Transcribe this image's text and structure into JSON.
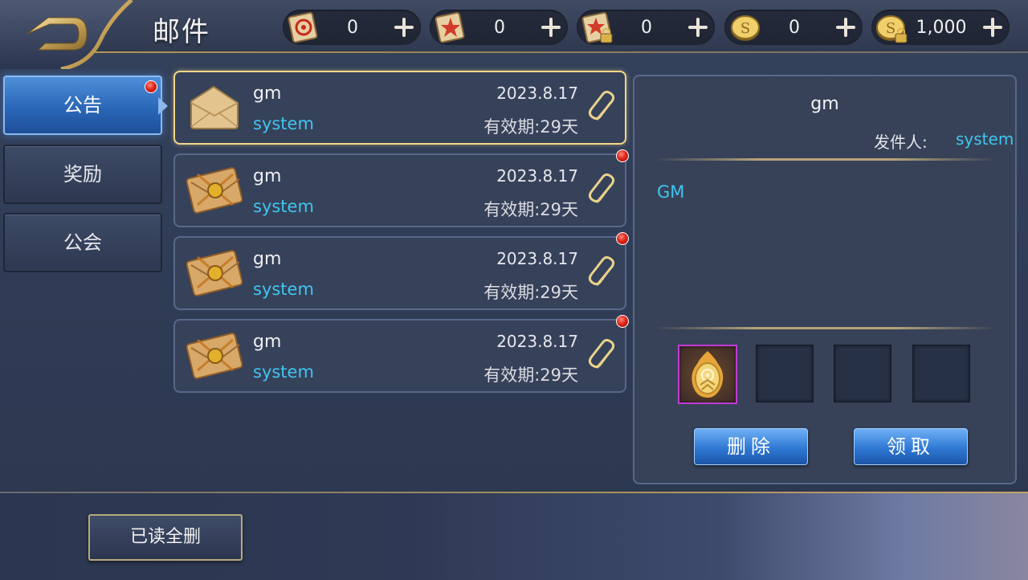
{
  "header": {
    "title": "邮件",
    "resources": [
      {
        "icon": "red-scroll-icon",
        "value": "0"
      },
      {
        "icon": "star-scroll-icon",
        "value": "0"
      },
      {
        "icon": "locked-scroll-icon",
        "value": "0"
      },
      {
        "icon": "gold-coin-icon",
        "value": "0"
      },
      {
        "icon": "locked-gold-coin-icon",
        "value": "1,000"
      }
    ]
  },
  "tabs": [
    {
      "label": "公告",
      "active": true,
      "unread": true
    },
    {
      "label": "奖励",
      "active": false,
      "unread": false
    },
    {
      "label": "公会",
      "active": false,
      "unread": false
    }
  ],
  "mails": [
    {
      "sender": "gm",
      "from": "system",
      "date": "2023.8.17",
      "expire": "有效期:29天",
      "opened": true,
      "unread": false
    },
    {
      "sender": "gm",
      "from": "system",
      "date": "2023.8.17",
      "expire": "有效期:29天",
      "opened": false,
      "unread": true
    },
    {
      "sender": "gm",
      "from": "system",
      "date": "2023.8.17",
      "expire": "有效期:29天",
      "opened": false,
      "unread": true
    },
    {
      "sender": "gm",
      "from": "system",
      "date": "2023.8.17",
      "expire": "有效期:29天",
      "opened": false,
      "unread": true
    }
  ],
  "detail": {
    "title": "gm",
    "sender_label": "发件人:",
    "sender": "system",
    "body": "GM",
    "attachments": [
      "golden-egg-icon",
      "",
      "",
      ""
    ],
    "delete_label": "删除",
    "claim_label": "领取"
  },
  "footer": {
    "delete_read_label": "已读全删"
  },
  "colors": {
    "accent_cyan": "#3fc6f0",
    "gold": "#f0d688",
    "tab_active": "#2a67b8",
    "badge_red": "#e0261a"
  }
}
